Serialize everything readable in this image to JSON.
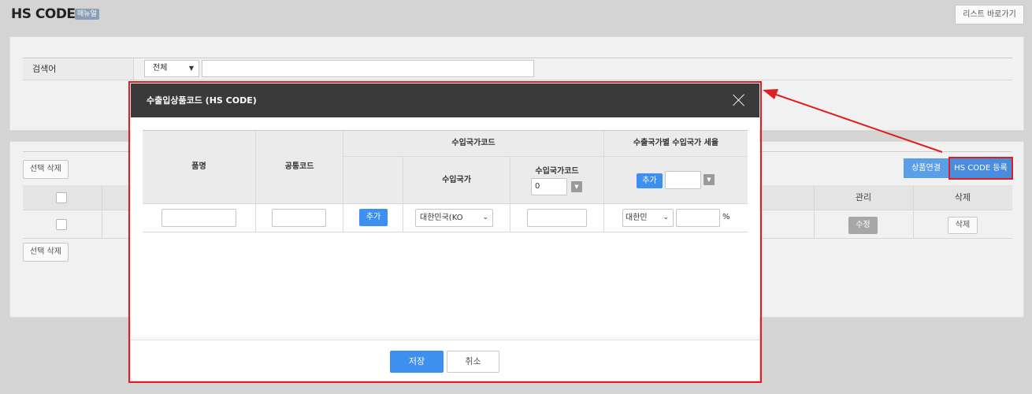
{
  "page": {
    "title": "HS CODE",
    "manual_badge": "매뉴얼",
    "list_button": "리스트 바로가기"
  },
  "search": {
    "label": "검색어",
    "scope_select": "전체"
  },
  "list": {
    "select_delete_label": "선택 삭제",
    "product_link_button": "상품연결",
    "hs_register_button": "HS CODE 등록",
    "columns": {
      "manage": "관리",
      "delete": "삭제"
    },
    "row": {
      "edit_label": "수정",
      "delete_label": "삭제"
    }
  },
  "modal": {
    "title": "수출입상품코드 (HS CODE)",
    "headers": {
      "item_name": "품명",
      "common_code": "공통코드",
      "import_country_code_group": "수입국가코드",
      "import_country": "수입국가",
      "import_country_code": "수입국가코드",
      "tax_group": "수출국가별 수입국가 세율"
    },
    "header_add_label": "추가",
    "header_code_default": "0",
    "row": {
      "add_label": "추가",
      "country_select": "대한민국(KO",
      "tax_country_select": "대한민",
      "percent": "%"
    },
    "save_label": "저장",
    "cancel_label": "취소"
  },
  "colors": {
    "accent_blue": "#3d8ff0",
    "highlight_red": "#e21d1d",
    "modal_header": "#3a3a3a"
  }
}
